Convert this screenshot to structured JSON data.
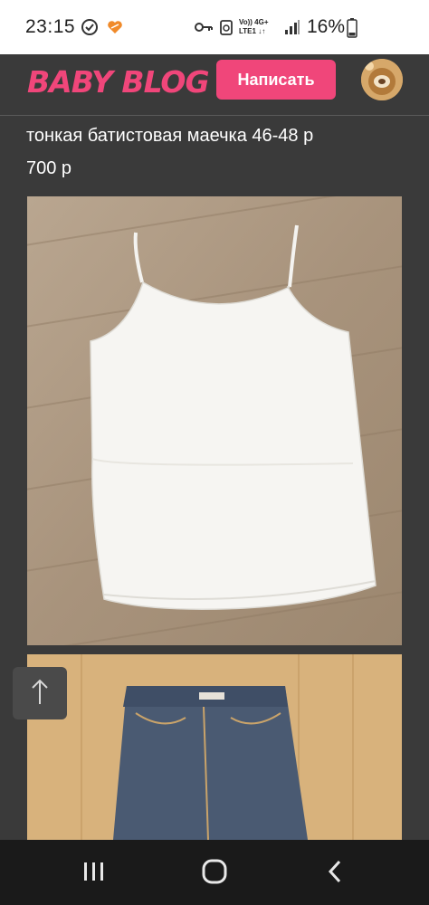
{
  "status_bar": {
    "time": "23:15",
    "network_top": "Vo)) 4G+",
    "network_bottom": "LTE1 ↓↑",
    "battery_percent": "16%"
  },
  "header": {
    "logo_text": "BABY BLOG",
    "write_button_label": "Написать"
  },
  "post": {
    "title": "тонкая батистовая маечка 46-48 р",
    "price": "700 р"
  },
  "colors": {
    "brand_pink": "#f0467a",
    "page_bg": "#3a3a3a"
  },
  "icons": {
    "scroll_top": "arrow-up-icon",
    "nav_recents": "recents-icon",
    "nav_home": "home-icon",
    "nav_back": "back-icon"
  }
}
